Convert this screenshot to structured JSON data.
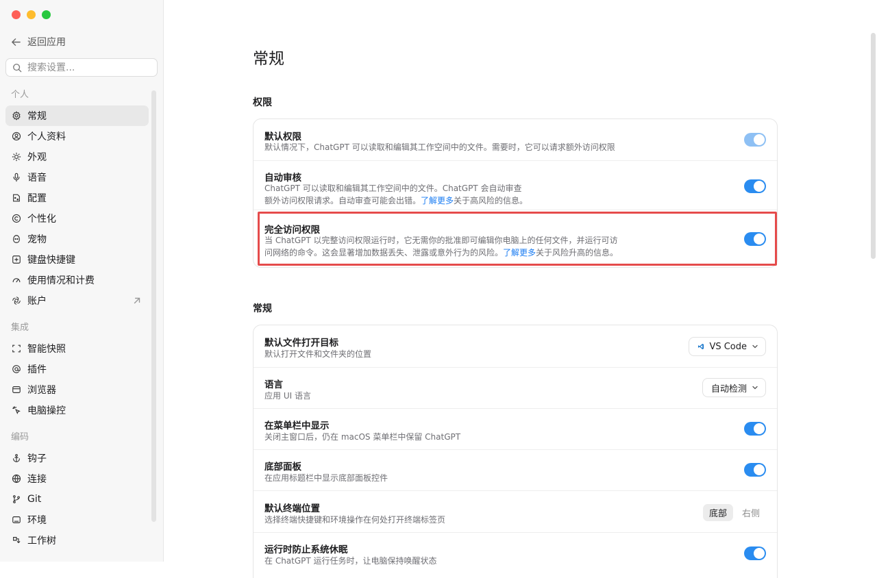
{
  "sidebar": {
    "back_label": "返回应用",
    "search_placeholder": "搜索设置...",
    "sections": [
      {
        "header": "个人",
        "items": [
          {
            "label": "常规",
            "icon": "gear-icon",
            "active": true
          },
          {
            "label": "个人资料",
            "icon": "user-circle-icon"
          },
          {
            "label": "外观",
            "icon": "sun-icon"
          },
          {
            "label": "语音",
            "icon": "microphone-icon"
          },
          {
            "label": "配置",
            "icon": "config-icon"
          },
          {
            "label": "个性化",
            "icon": "personalize-icon"
          },
          {
            "label": "宠物",
            "icon": "pet-icon"
          },
          {
            "label": "键盘快捷键",
            "icon": "keyboard-icon"
          },
          {
            "label": "使用情况和计费",
            "icon": "gauge-icon"
          },
          {
            "label": "账户",
            "icon": "openai-icon",
            "external": true
          }
        ]
      },
      {
        "header": "集成",
        "items": [
          {
            "label": "智能快照",
            "icon": "snapshot-icon"
          },
          {
            "label": "插件",
            "icon": "at-icon"
          },
          {
            "label": "浏览器",
            "icon": "browser-icon"
          },
          {
            "label": "电脑操控",
            "icon": "cursor-click-icon"
          }
        ]
      },
      {
        "header": "编码",
        "items": [
          {
            "label": "钩子",
            "icon": "anchor-icon"
          },
          {
            "label": "连接",
            "icon": "globe-icon"
          },
          {
            "label": "Git",
            "icon": "git-branch-icon"
          },
          {
            "label": "环境",
            "icon": "terminal-box-icon"
          },
          {
            "label": "工作树",
            "icon": "worktree-icon"
          }
        ]
      }
    ]
  },
  "main": {
    "title": "常规",
    "permissions": {
      "title": "权限",
      "rows": [
        {
          "title": "默认权限",
          "desc": "默认情况下，ChatGPT 可以读取和编辑其工作空间中的文件。需要时，它可以请求额外访问权限",
          "on": true
        },
        {
          "title": "自动审核",
          "desc_line1": "ChatGPT 可以读取和编辑其工作空间中的文件。ChatGPT 会自动审查",
          "desc_line2_pre": "额外访问权限请求。自动审查可能会出错。",
          "link": "了解更多",
          "desc_line2_post": "关于高风险的信息。",
          "on": true
        },
        {
          "title": "完全访问权限",
          "desc_line1": "当 ChatGPT 以完整访问权限运行时，它无需你的批准即可编辑你电脑上的任何文件，并运行可访",
          "desc_line2_pre": "问网络的命令。这会显著增加数据丢失、泄露或意外行为的风险。",
          "link": "了解更多",
          "desc_line2_post": "关于风险升高的信息。",
          "on": true
        }
      ]
    },
    "general": {
      "title": "常规",
      "rows": [
        {
          "title": "默认文件打开目标",
          "desc": "默认打开文件和文件夹的位置",
          "value": "VS Code"
        },
        {
          "title": "语言",
          "desc": "应用 UI 语言",
          "value": "自动检测"
        },
        {
          "title": "在菜单栏中显示",
          "desc": "关闭主窗口后，仍在 macOS 菜单栏中保留 ChatGPT",
          "on": true
        },
        {
          "title": "底部面板",
          "desc": "在应用标题栏中显示底部面板控件",
          "on": true
        },
        {
          "title": "默认终端位置",
          "desc": "选择终端快捷键和环境操作在何处打开终端标签页",
          "options": [
            "底部",
            "右侧"
          ],
          "selected": "底部"
        },
        {
          "title": "运行时防止系统休眠",
          "desc": "在 ChatGPT 运行任务时，让电脑保持唤醒状态",
          "on": true
        }
      ]
    }
  },
  "colors": {
    "accent": "#2a8cf0",
    "highlight": "#e54b4b",
    "link": "#1a7cf2"
  }
}
